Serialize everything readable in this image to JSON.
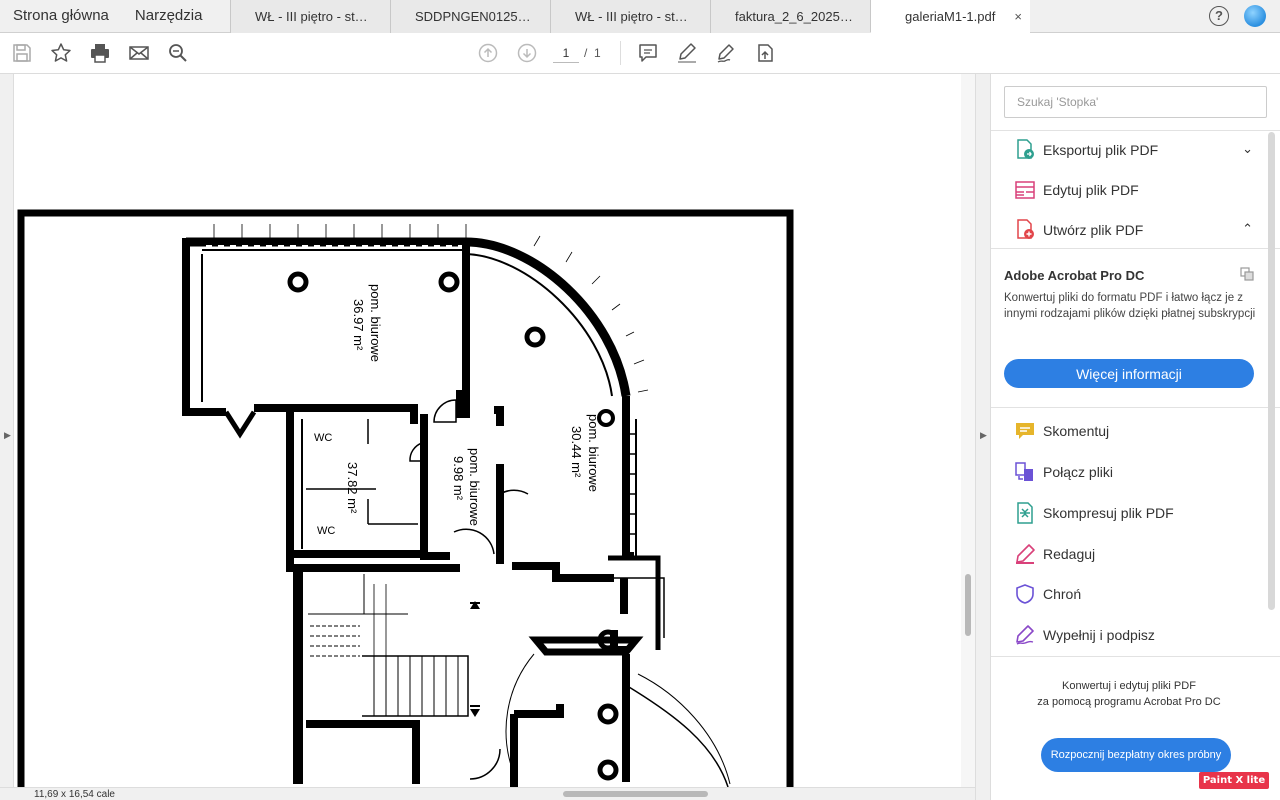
{
  "app": {
    "nav": [
      "Strona główna",
      "Narzędzia"
    ],
    "tabs": [
      {
        "label": "WŁ - III piętro - st…",
        "active": false
      },
      {
        "label": "SDDPNGEN0125…",
        "active": false
      },
      {
        "label": "WŁ - III piętro - st…",
        "active": false
      },
      {
        "label": "faktura_2_6_2025…",
        "active": false
      },
      {
        "label": "galeriaM1-1.pdf",
        "active": true
      }
    ],
    "tab_close": "×",
    "help": "?"
  },
  "toolbar": {
    "current_page": "1",
    "page_separator": "/",
    "total_pages": "1"
  },
  "status": {
    "page_size": "11,69 x 16,54 cale"
  },
  "plan": {
    "room1_name": "pom. biurowe",
    "room1_area": "36.97 m²",
    "room2_name": "pom. biurowe",
    "room2_area": "30.44 m²",
    "room3_name": "pom. biurowe",
    "room3_area": "9.98 m²",
    "wc_area": "37.82 m²",
    "wc1": "WC",
    "wc2": "WC"
  },
  "rightpane": {
    "search_placeholder": "Szukaj 'Stopka'",
    "tools_top": [
      {
        "label": "Eksportuj plik PDF",
        "chevron": "⌄",
        "color": "#2e9f8f"
      },
      {
        "label": "Edytuj plik PDF",
        "color": "#d9417a"
      },
      {
        "label": "Utwórz plik PDF",
        "chevron": "⌃",
        "color": "#e2454a"
      }
    ],
    "promo_title": "Adobe Acrobat Pro DC",
    "promo_text": "Konwertuj pliki do formatu PDF i łatwo łącz je z innymi rodzajami plików dzięki płatnej subskrypcji",
    "more_info": "Więcej informacji",
    "tools": [
      {
        "label": "Skomentuj",
        "color": "#e6b52b"
      },
      {
        "label": "Połącz pliki",
        "color": "#6b52d6"
      },
      {
        "label": "Skompresuj plik PDF",
        "color": "#2e9f8f"
      },
      {
        "label": "Redaguj",
        "color": "#d9417a"
      },
      {
        "label": "Chroń",
        "color": "#6b52d6"
      },
      {
        "label": "Wypełnij i podpisz",
        "color": "#8a48c8"
      }
    ],
    "bottom_promo_line1": "Konwertuj i edytuj pliki PDF",
    "bottom_promo_line2": "za pomocą programu Acrobat Pro DC",
    "trial": "Rozpocznij bezpłatny okres próbny"
  },
  "watermark": "Paint X lite"
}
